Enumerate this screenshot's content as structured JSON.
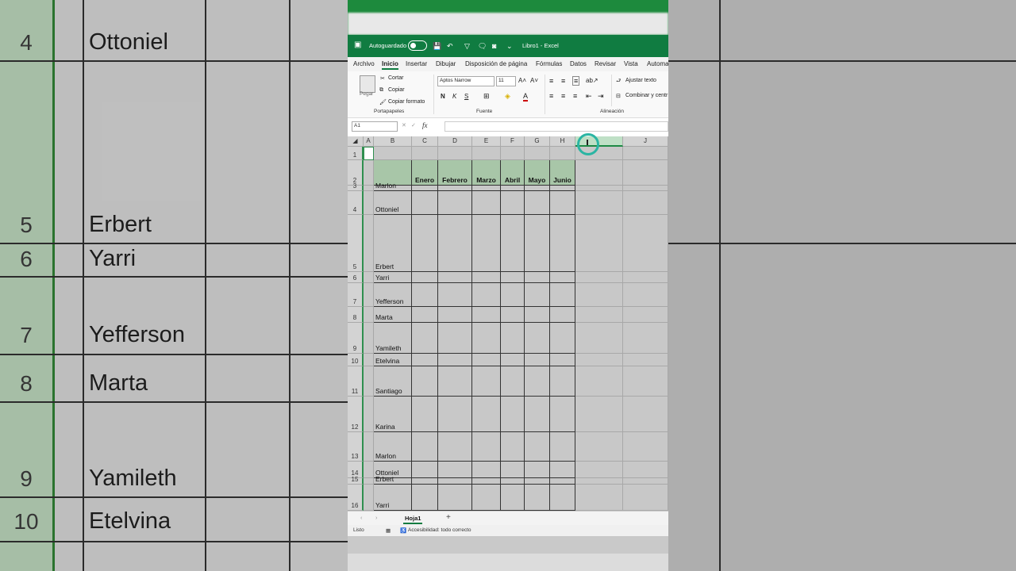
{
  "background": {
    "left_rows": [
      {
        "num": "4",
        "name": "Ottoniel"
      },
      {
        "num": "5",
        "name": "Erbert"
      },
      {
        "num": "6",
        "name": "Yarri"
      },
      {
        "num": "7",
        "name": "Yefferson"
      },
      {
        "num": "8",
        "name": "Marta"
      },
      {
        "num": "9",
        "name": "Yamileth"
      },
      {
        "num": "10",
        "name": "Etelvina"
      }
    ]
  },
  "titlebar": {
    "autosave_label": "Autoguardado",
    "doc_title": "Libro1 - Excel"
  },
  "menu": {
    "items": [
      "Archivo",
      "Inicio",
      "Insertar",
      "Dibujar",
      "Disposición de página",
      "Fórmulas",
      "Datos",
      "Revisar",
      "Vista",
      "Automa"
    ],
    "active": "Inicio"
  },
  "ribbon": {
    "paste": "Pegar",
    "cut": "Cortar",
    "copy": "Copiar",
    "format_painter": "Copiar formato",
    "clipboard_group": "Portapapeles",
    "font_name": "Aptos Narrow",
    "font_size": "11",
    "bold": "N",
    "italic": "K",
    "underline": "S",
    "font_group": "Fuente",
    "wrap_text": "Ajustar texto",
    "merge_center": "Combinar y centr",
    "alignment_group": "Alineación"
  },
  "formula_bar": {
    "name_box": "A1",
    "fx": "fx",
    "value": ""
  },
  "grid": {
    "columns": [
      "A",
      "B",
      "C",
      "D",
      "E",
      "F",
      "G",
      "H",
      "I",
      "J"
    ],
    "selected_column": "I",
    "row_numbers": [
      "1",
      "2",
      "3",
      "4",
      "5",
      "6",
      "7",
      "8",
      "9",
      "10",
      "11",
      "12",
      "13",
      "14",
      "15",
      "16"
    ],
    "table_headers": [
      "",
      "Enero",
      "Febrero",
      "Marzo",
      "Abril",
      "Mayo",
      "Junio"
    ],
    "names": [
      "Marlon",
      "Ottoniel",
      "Erbert",
      "Yarri",
      "Yefferson",
      "Marta",
      "Yamileth",
      "Etelvina",
      "Santiago",
      "Karina",
      "Marlon",
      "Ottoniel",
      "Erbert",
      "Yarri"
    ]
  },
  "sheet_tabs": {
    "active": "Hoja1",
    "add": "+"
  },
  "status_bar": {
    "ready": "Listo",
    "accessibility": "Accesibilidad: todo correcto"
  },
  "colors": {
    "excel_green": "#107c41",
    "table_header": "#a8c6a8",
    "selection_ring": "#2bb5a3"
  }
}
